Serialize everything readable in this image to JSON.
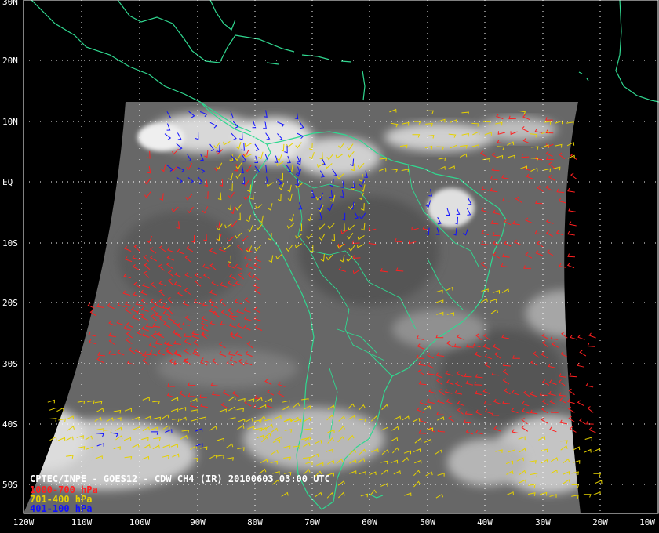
{
  "caption": {
    "title": "CPTEC/INPE - GOES12 - CDW CH4 (IR) 20100603 03:00 UTC",
    "legend": [
      {
        "label": "1000-700 hPa",
        "color": "#ff2020"
      },
      {
        "label": "701-400 hPa",
        "color": "#e6d200"
      },
      {
        "label": "401-100 hPa",
        "color": "#1010ff"
      }
    ]
  },
  "grid": {
    "lat_labels": [
      "30N",
      "20N",
      "10N",
      "EQ",
      "10S",
      "20S",
      "30S",
      "40S",
      "50S"
    ],
    "lon_labels": [
      "120W",
      "110W",
      "100W",
      "90W",
      "80W",
      "70W",
      "60W",
      "50W",
      "40W",
      "30W",
      "20W",
      "10W"
    ]
  },
  "colors": {
    "background": "#000000",
    "coastline": "#30d890",
    "grid_dots": "#ffffff",
    "satellite_gray": "#6a6a6a",
    "low_level_winds": "#ff2020",
    "mid_level_winds": "#e6d200",
    "high_level_winds": "#1010ff"
  }
}
